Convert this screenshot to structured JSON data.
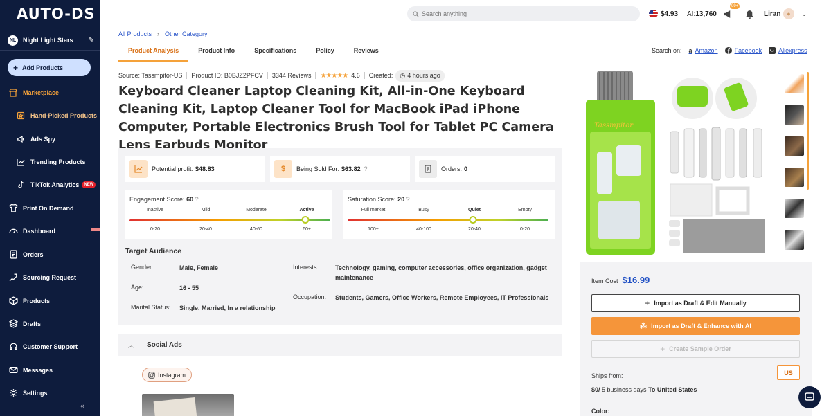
{
  "app": {
    "logo": "AUTO-DS"
  },
  "store": {
    "initials": "NL",
    "name": "Night Light Stars"
  },
  "sidebar": {
    "add_products": "Add Products",
    "items": [
      {
        "label": "Marketplace",
        "icon": "shop-icon",
        "active": true
      },
      {
        "label": "Hand-Picked Products",
        "icon": "box-star-icon",
        "sub": true
      },
      {
        "label": "Ads Spy",
        "icon": "megaphone-icon",
        "sub": true
      },
      {
        "label": "Trending Products",
        "icon": "trend-icon",
        "sub": true
      },
      {
        "label": "TikTok Analytics",
        "icon": "tiktok-icon",
        "sub": true,
        "badge": "NEW"
      },
      {
        "label": "Print On Demand",
        "icon": "shirt-icon"
      },
      {
        "label": "Dashboard",
        "icon": "dashboard-icon"
      },
      {
        "label": "Orders",
        "icon": "orders-icon"
      },
      {
        "label": "Sourcing Request",
        "icon": "sourcing-icon"
      },
      {
        "label": "Products",
        "icon": "products-icon"
      },
      {
        "label": "Drafts",
        "icon": "drafts-icon"
      },
      {
        "label": "Customer Support",
        "icon": "support-icon"
      },
      {
        "label": "Messages",
        "icon": "mail-icon"
      },
      {
        "label": "Settings",
        "icon": "gear-icon"
      }
    ]
  },
  "topbar": {
    "search_placeholder": "Search anything",
    "balance": "$4.93",
    "ai_prefix": "AI:",
    "ai_credits": "13,760",
    "notif_badge": "99+",
    "user": "Liran"
  },
  "breadcrumb": {
    "root": "All Products",
    "current": "Other Category"
  },
  "tabs": [
    "Product Analysis",
    "Product Info",
    "Specifications",
    "Policy",
    "Reviews"
  ],
  "search_on": {
    "label": "Search on:",
    "links": [
      "Amazon",
      "Facebook",
      "Aliexpress"
    ]
  },
  "product": {
    "source": "Source: Tassmpitor-US",
    "product_id": "Product ID: B0BJZ2PFCV",
    "reviews": "3344 Reviews",
    "rating": "4.6",
    "created_label": "Created:",
    "created": "4 hours ago",
    "title": "Keyboard Cleaner Laptop Cleaning Kit, All-in-One Keyboard Cleaning Kit, Laptop Cleaner Tool for MacBook iPad iPhone Computer, Portable Electronics Brush Tool for Tablet PC Camera Lens Earbuds Monitor"
  },
  "analysis": {
    "profit_label": "Potential profit:",
    "profit": "$48.83",
    "sold_label": "Being Sold For:",
    "sold": "$63.82",
    "orders_label": "Orders:",
    "orders": "0",
    "engagement": {
      "label": "Engagement Score:",
      "value": "60",
      "level": 0.875,
      "levels": [
        "Inactive",
        "Mild",
        "Moderate",
        "Active"
      ],
      "ranges": [
        "0-20",
        "20-40",
        "40-60",
        "60+"
      ]
    },
    "saturation": {
      "label": "Saturation Score:",
      "value": "20",
      "level": 0.625,
      "levels": [
        "Full market",
        "Busy",
        "Quiet",
        "Empty"
      ],
      "ranges": [
        "100+",
        "40-100",
        "20-40",
        "0-20"
      ]
    },
    "target": {
      "title": "Target Audience",
      "gender_label": "Gender:",
      "gender": "Male, Female",
      "age_label": "Age:",
      "age": "16 - 55",
      "marital_label": "Marital Status:",
      "marital": "Single, Married, In a relationship",
      "interests_label": "Interests:",
      "interests": "Technology, gaming, computer accessories, office organization, gadget maintenance",
      "occupation_label": "Occupation:",
      "occupation": "Students, Gamers, Office Workers, Remote Employees, IT Professionals"
    }
  },
  "social": {
    "title": "Social Ads",
    "platform": "Instagram"
  },
  "gallery": {
    "brand": "Tassmpitor"
  },
  "purchase": {
    "item_cost_label": "Item Cost",
    "item_cost": "$16.99",
    "import_edit": "Import as Draft & Edit Manually",
    "import_ai": "Import as Draft & Enhance with AI",
    "sample_order": "Create Sample Order",
    "ships_from_label": "Ships from:",
    "country": "US",
    "shipping_cost": "$0/",
    "shipping_days": " 5 business days ",
    "shipping_to": "To United States",
    "color_label": "Color:"
  },
  "colors": {
    "accent": "#f5a23a",
    "sidebar": "#0e1c3d",
    "link": "#2a55c9",
    "price": "#1f4fc4"
  }
}
